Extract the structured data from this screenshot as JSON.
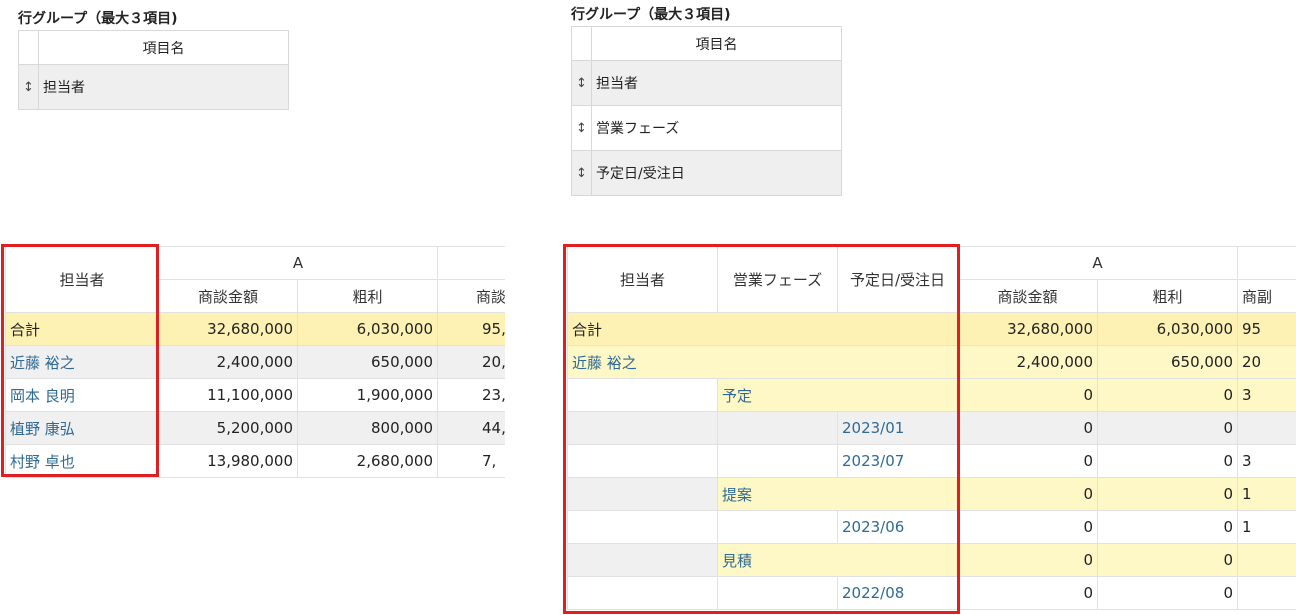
{
  "left": {
    "group": {
      "title": "行グループ（最大３項目)",
      "header": "項目名",
      "items": [
        {
          "label": "担当者"
        }
      ]
    },
    "pivot": {
      "row_header": "担当者",
      "column_group": "A",
      "columns": [
        "商談金額",
        "粗利",
        "商談"
      ],
      "rows": [
        {
          "label": "合計",
          "values": [
            "32,680,000",
            "6,030,000",
            "95,"
          ]
        },
        {
          "label": "近藤 裕之",
          "values": [
            "2,400,000",
            "650,000",
            "20,"
          ]
        },
        {
          "label": "岡本 良明",
          "values": [
            "11,100,000",
            "1,900,000",
            "23,"
          ]
        },
        {
          "label": "植野 康弘",
          "values": [
            "5,200,000",
            "800,000",
            "44,"
          ]
        },
        {
          "label": "村野 卓也",
          "values": [
            "13,980,000",
            "2,680,000",
            "7,"
          ]
        }
      ]
    }
  },
  "right": {
    "group": {
      "title": "行グループ（最大３項目)",
      "header": "項目名",
      "items": [
        {
          "label": "担当者"
        },
        {
          "label": "営業フェーズ"
        },
        {
          "label": "予定日/受注日"
        }
      ]
    },
    "pivot": {
      "row_headers": [
        "担当者",
        "営業フェーズ",
        "予定日/受注日"
      ],
      "column_group": "A",
      "column_group_next": "",
      "columns": [
        "商談金額",
        "粗利",
        "商副"
      ],
      "rows": [
        {
          "c1": "合計",
          "c2": "",
          "c3": "",
          "values": [
            "32,680,000",
            "6,030,000",
            "95"
          ]
        },
        {
          "c1": "近藤 裕之",
          "c2": "",
          "c3": "",
          "values": [
            "2,400,000",
            "650,000",
            "20"
          ]
        },
        {
          "c1": "",
          "c2": "予定",
          "c3": "",
          "values": [
            "0",
            "0",
            "3"
          ]
        },
        {
          "c1": "",
          "c2": "",
          "c3": "2023/01",
          "values": [
            "0",
            "0",
            ""
          ]
        },
        {
          "c1": "",
          "c2": "",
          "c3": "2023/07",
          "values": [
            "0",
            "0",
            "3"
          ]
        },
        {
          "c1": "",
          "c2": "提案",
          "c3": "",
          "values": [
            "0",
            "0",
            "1"
          ]
        },
        {
          "c1": "",
          "c2": "",
          "c3": "2023/06",
          "values": [
            "0",
            "0",
            "1"
          ]
        },
        {
          "c1": "",
          "c2": "見積",
          "c3": "",
          "values": [
            "0",
            "0",
            ""
          ]
        },
        {
          "c1": "",
          "c2": "",
          "c3": "2022/08",
          "values": [
            "0",
            "0",
            ""
          ]
        }
      ]
    }
  },
  "icons": {
    "drag_handle": "↕"
  }
}
